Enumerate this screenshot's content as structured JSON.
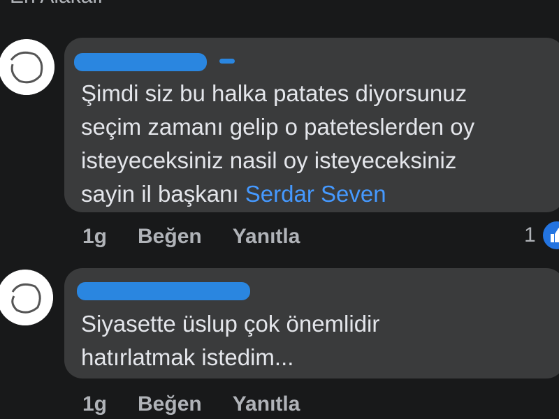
{
  "header": {
    "cut_text": "En Alakalı"
  },
  "comments": [
    {
      "text_before_mention": "Şimdi siz bu halka patates  diyorsunuz\nseçim zamanı gelip o pateteslerden oy\nisteyeceksiniz nasil oy isteyeceksiniz\nsayin il başkanı ",
      "mention": "Serdar Seven",
      "time": "1g",
      "like_label": "Beğen",
      "reply_label": "Yanıtla",
      "reaction_count": "1"
    },
    {
      "text": "Siyasette üslup çok önemlidir\nhatırlatmak istedim...",
      "time": "1g",
      "like_label": "Beğen",
      "reply_label": "Yanıtla"
    }
  ],
  "colors": {
    "background": "#18191a",
    "bubble": "#3a3b3c",
    "mention": "#4599ff",
    "redaction": "#2a86e0",
    "like": "#2374e1"
  },
  "icons": {
    "reaction": "thumbs-up-icon"
  }
}
